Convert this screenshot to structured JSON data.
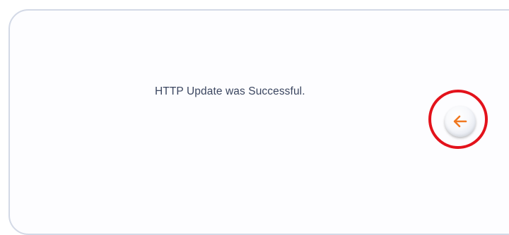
{
  "status": {
    "message": "HTTP Update was Successful."
  },
  "actions": {
    "back_icon": "arrow-left-icon",
    "back_icon_color": "#f07820",
    "highlight_color": "#e3121b"
  }
}
